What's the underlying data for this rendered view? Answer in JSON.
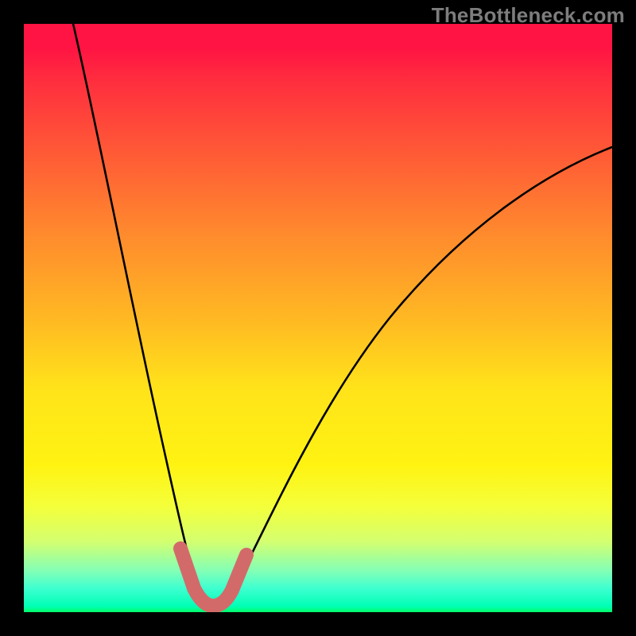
{
  "watermark": "TheBottleneck.com",
  "chart_data": {
    "type": "line",
    "title": "",
    "xlabel": "",
    "ylabel": "",
    "xlim": [
      0,
      100
    ],
    "ylim": [
      0,
      100
    ],
    "grid": false,
    "legend": false,
    "series": [
      {
        "name": "bottleneck-curve",
        "x": [
          0,
          5,
          10,
          15,
          20,
          23,
          26,
          29,
          31,
          34,
          40,
          48,
          58,
          70,
          85,
          100
        ],
        "y": [
          100,
          80,
          60,
          42,
          26,
          15,
          6,
          1,
          0,
          2,
          10,
          26,
          44,
          60,
          72,
          80
        ]
      }
    ],
    "annotations": [
      {
        "name": "optimal-region",
        "x_range": [
          26,
          36
        ],
        "y_range": [
          0,
          8
        ]
      }
    ]
  }
}
